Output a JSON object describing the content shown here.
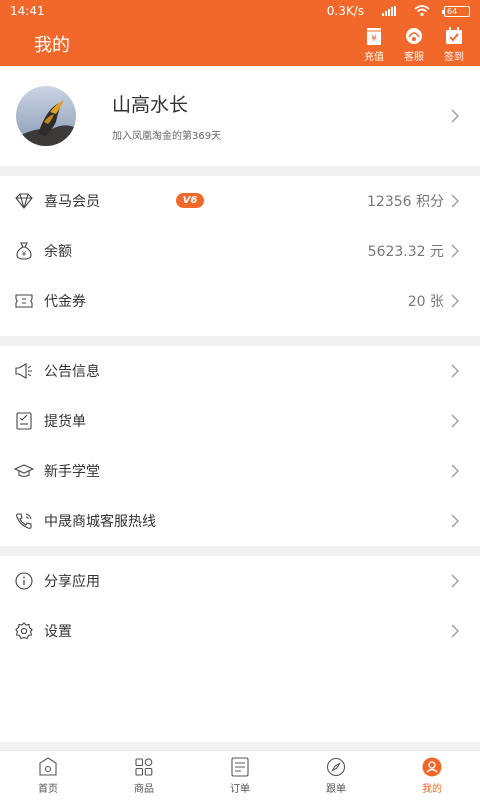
{
  "status": {
    "time": "14:41",
    "speed": "0.3K/s",
    "battery": "64"
  },
  "header": {
    "title": "我的",
    "buttons": [
      {
        "label": "充值",
        "icon": "recharge-icon"
      },
      {
        "label": "客服",
        "icon": "customer-service-icon"
      },
      {
        "label": "签到",
        "icon": "checkin-icon"
      }
    ]
  },
  "profile": {
    "name": "山高水长",
    "subtitle": "加入凤凰淘金的第369天"
  },
  "account": [
    {
      "label": "喜马会员",
      "badge": "V6",
      "value": "12356 积分",
      "icon": "diamond-icon"
    },
    {
      "label": "余额",
      "value": "5623.32 元",
      "icon": "money-bag-icon"
    },
    {
      "label": "代金券",
      "value": "20 张",
      "icon": "coupon-icon"
    }
  ],
  "services": [
    {
      "label": "公告信息",
      "icon": "megaphone-icon"
    },
    {
      "label": "提货单",
      "icon": "checklist-icon"
    },
    {
      "label": "新手学堂",
      "icon": "graduation-cap-icon"
    },
    {
      "label": "中晟商城客服热线",
      "icon": "phone-icon"
    }
  ],
  "others": [
    {
      "label": "分享应用",
      "icon": "info-icon"
    },
    {
      "label": "设置",
      "icon": "gear-icon"
    }
  ],
  "tabs": [
    {
      "label": "首页",
      "icon": "home-icon"
    },
    {
      "label": "商品",
      "icon": "grid-icon"
    },
    {
      "label": "订单",
      "icon": "order-list-icon"
    },
    {
      "label": "跟单",
      "icon": "compass-icon"
    },
    {
      "label": "我的",
      "icon": "user-icon",
      "active": true
    }
  ],
  "colors": {
    "accent": "#f2682a"
  }
}
